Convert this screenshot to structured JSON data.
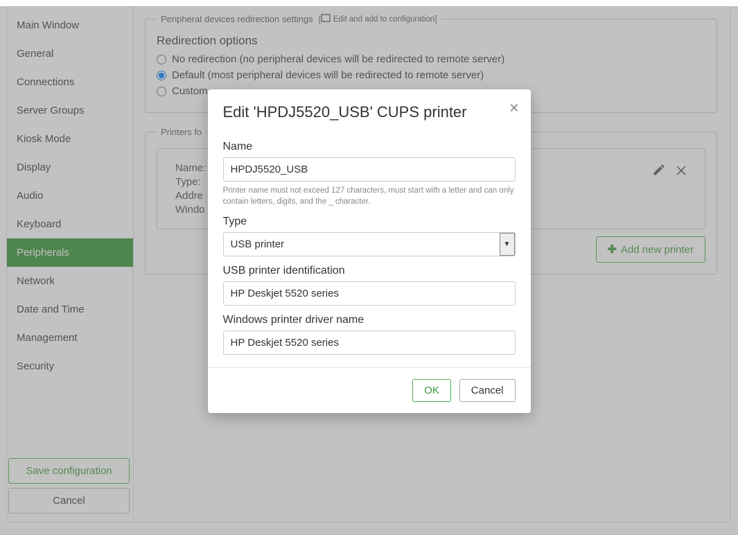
{
  "sidebar": {
    "items": [
      "Main Window",
      "General",
      "Connections",
      "Server Groups",
      "Kiosk Mode",
      "Display",
      "Audio",
      "Keyboard",
      "Peripherals",
      "Network",
      "Date and Time",
      "Management",
      "Security"
    ],
    "active_index": 8,
    "save_label": "Save configuration",
    "cancel_label": "Cancel"
  },
  "redirection_panel": {
    "legend": "Peripheral devices redirection settings",
    "edit_badge": "Edit and add to configuration]",
    "title": "Redirection options",
    "options": [
      "No redirection (no peripheral devices will be redirected to remote server)",
      "Default (most peripheral devices will be redirected to remote server)",
      "Custom"
    ],
    "selected_index": 1
  },
  "printers_panel": {
    "legend": "Printers fo",
    "card": {
      "name_label": "Name:",
      "type_label": "Type:",
      "address_label": "Addre",
      "windows_label": "Windo"
    },
    "add_button": "Add new printer"
  },
  "modal": {
    "title": "Edit 'HPDJ5520_USB' CUPS printer",
    "labels": {
      "name": "Name",
      "type": "Type",
      "usb_id": "USB printer identification",
      "win_driver": "Windows printer driver name"
    },
    "values": {
      "name": "HPDJ5520_USB",
      "type": "USB printer",
      "usb_id": "HP Deskjet 5520 series",
      "win_driver": "HP Deskjet 5520 series"
    },
    "name_helper": "Printer name must not exceed 127 characters, must start with a letter and can only contain letters, digits, and the _ character.",
    "ok_label": "OK",
    "cancel_label": "Cancel"
  }
}
